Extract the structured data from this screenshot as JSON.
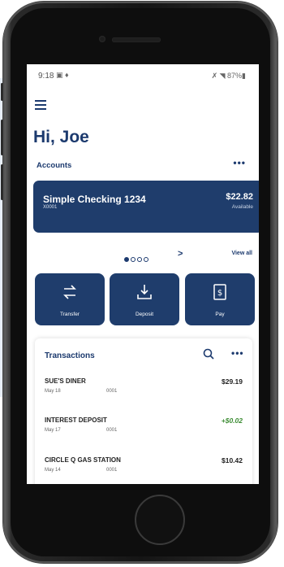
{
  "status_bar": {
    "time": "9:18",
    "notification_icons": "▣ ♦",
    "right": "✗ ◥ 87%▮"
  },
  "greeting": "Hi, Joe",
  "accounts": {
    "label": "Accounts",
    "more": "•••",
    "card": {
      "name": "Simple Checking 1234",
      "number": "X0001",
      "balance": "$22.82",
      "balance_label": "Available"
    },
    "pager": {
      "total": 4,
      "active": 1,
      "next": ">"
    },
    "view_all": "View all"
  },
  "actions": [
    {
      "label": "Transfer",
      "icon": "transfer-icon"
    },
    {
      "label": "Deposit",
      "icon": "deposit-icon"
    },
    {
      "label": "Pay",
      "icon": "pay-icon"
    }
  ],
  "transactions": {
    "title": "Transactions",
    "more": "•••",
    "rows": [
      {
        "name": "SUE'S DINER",
        "date": "May 18",
        "ref": "0001",
        "amount": "$29.19",
        "type": "debit"
      },
      {
        "name": "INTEREST DEPOSIT",
        "date": "May 17",
        "ref": "0001",
        "amount": "+$0.02",
        "type": "credit"
      },
      {
        "name": "CIRCLE Q GAS STATION",
        "date": "May 14",
        "ref": "0001",
        "amount": "$10.42",
        "type": "debit"
      }
    ]
  },
  "colors": {
    "brand_navy": "#1f3d6c",
    "credit_green": "#3c8c33",
    "background_panel": "#e7eef7"
  }
}
